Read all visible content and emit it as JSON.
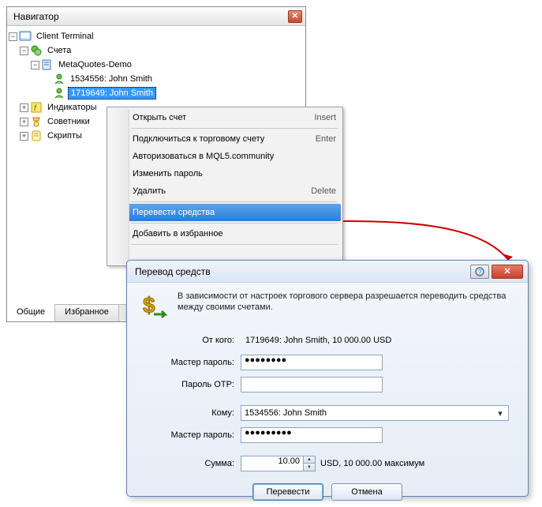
{
  "navigator": {
    "title": "Навигатор",
    "tree": {
      "root": "Client Terminal",
      "accounts": "Счета",
      "server": "MetaQuotes-Demo",
      "account1": "1534556: John Smith",
      "account2": "1719649: John Smith",
      "indicators": "Индикаторы",
      "advisors": "Советники",
      "scripts": "Скрипты"
    },
    "tabs": {
      "general": "Общие",
      "favorites": "Избранное"
    }
  },
  "menu": {
    "open_account": "Открыть счет",
    "open_account_sc": "Insert",
    "connect": "Подключиться к торговому счету",
    "connect_sc": "Enter",
    "authorize": "Авторизоваться в MQL5.community",
    "change_pass": "Изменить пароль",
    "delete": "Удалить",
    "delete_sc": "Delete",
    "transfer": "Перевести средства",
    "favorite": "Добавить в избранное"
  },
  "dialog": {
    "title": "Перевод средств",
    "info": "В зависимости от настроек торгового сервера разрешается переводить средства между своими счетами.",
    "from_label": "От кого:",
    "from_value": "1719649: John Smith, 10 000.00 USD",
    "master_pass_label": "Мастер пароль:",
    "master_pass_value": "●●●●●●●●",
    "otp_label": "Пароль OTP:",
    "otp_value": "",
    "to_label": "Кому:",
    "to_value": "1534556: John Smith",
    "master_pass2_value": "●●●●●●●●●",
    "amount_label": "Сумма:",
    "amount_value": "10.00",
    "amount_suffix": "USD, 10 000.00 максимум",
    "btn_transfer": "Перевести",
    "btn_cancel": "Отмена"
  }
}
